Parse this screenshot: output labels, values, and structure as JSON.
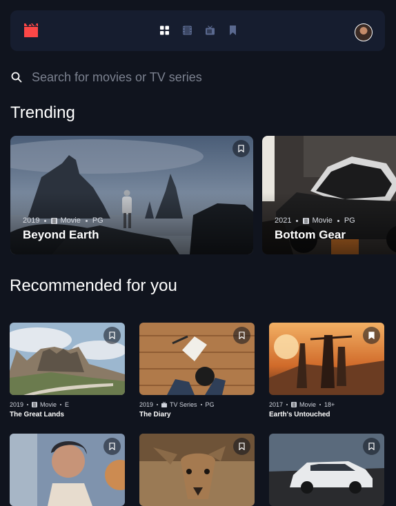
{
  "nav": {
    "logo_icon": "film-clapper-icon",
    "logo_color": "#FC4747",
    "items": [
      {
        "icon": "grid-icon",
        "active": true
      },
      {
        "icon": "film-icon",
        "active": false
      },
      {
        "icon": "tv-icon",
        "active": false
      },
      {
        "icon": "bookmark-icon",
        "active": false
      }
    ],
    "avatar_icon": "user-avatar"
  },
  "search": {
    "icon": "search-icon",
    "placeholder": "Search for movies or TV series"
  },
  "trending": {
    "heading": "Trending",
    "items": [
      {
        "year": "2019",
        "category": "Movie",
        "category_icon": "film-icon",
        "rating": "PG",
        "title": "Beyond Earth"
      },
      {
        "year": "2021",
        "category": "Movie",
        "category_icon": "film-icon",
        "rating": "PG",
        "title": "Bottom Gear"
      }
    ]
  },
  "recommended": {
    "heading": "Recommended for you",
    "items": [
      {
        "year": "2019",
        "category": "Movie",
        "category_icon": "film-icon",
        "rating": "E",
        "title": "The Great Lands"
      },
      {
        "year": "2019",
        "category": "TV Series",
        "category_icon": "tv-icon",
        "rating": "PG",
        "title": "The Diary"
      },
      {
        "year": "2017",
        "category": "Movie",
        "category_icon": "film-icon",
        "rating": "18+",
        "title": "Earth's Untouched"
      }
    ]
  },
  "colors": {
    "background": "#10141E",
    "surface": "#161D2F",
    "accent": "#FC4747",
    "muted": "#5A698F"
  }
}
